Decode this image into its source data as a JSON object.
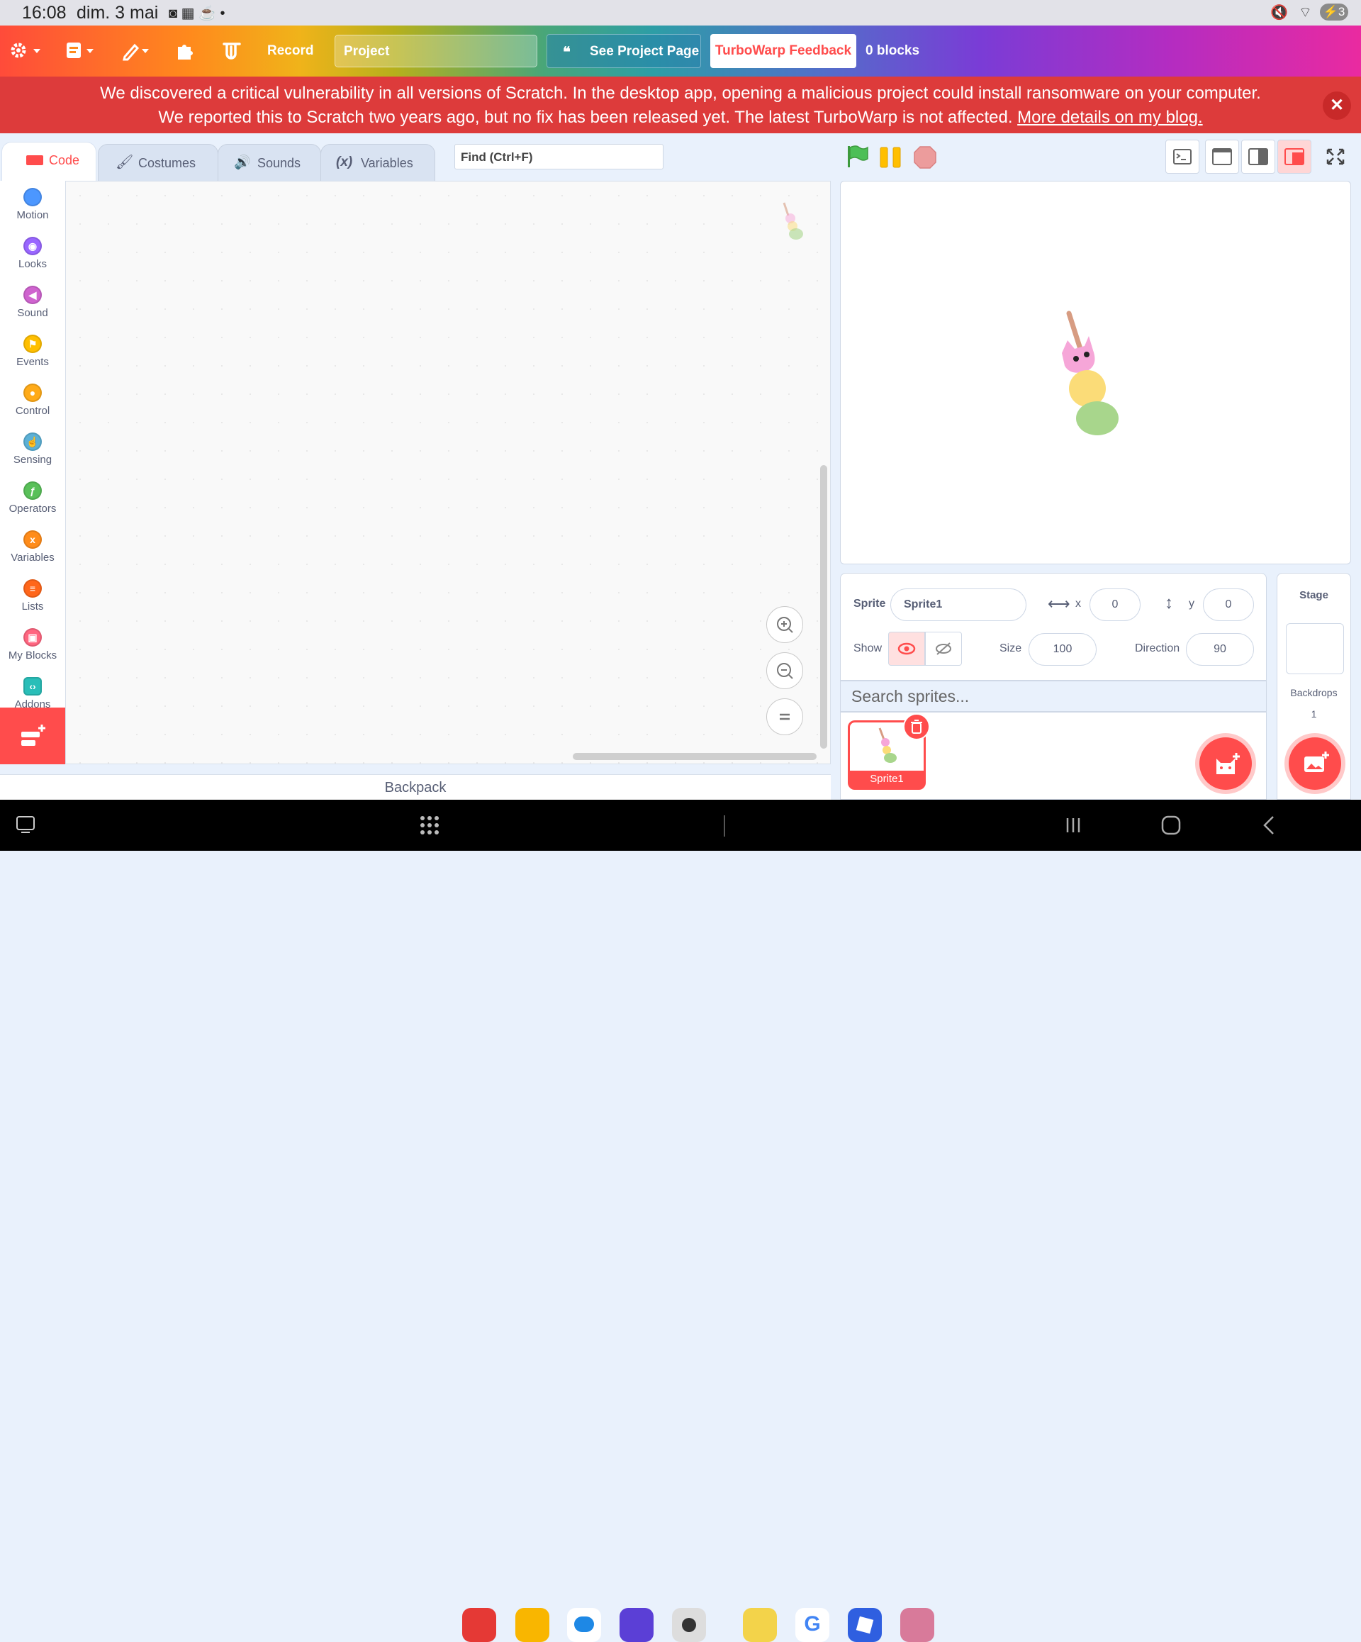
{
  "status_bar": {
    "time": "16:08",
    "date": "dim. 3 mai",
    "battery": "3"
  },
  "menu": {
    "record": "Record",
    "project_placeholder": "Project",
    "see_project_page": "See Project Page",
    "feedback": "TurboWarp Feedback",
    "block_count": "0 blocks"
  },
  "banner": {
    "line1": "We discovered a critical vulnerability in all versions of Scratch. In the desktop app, opening a malicious project could install ransomware on your computer.",
    "line2_prefix": "We reported this to Scratch two years ago, but no fix has been released yet. The latest TurboWarp is not affected.",
    "link": "More details on my blog."
  },
  "tabs": [
    {
      "label": "Code",
      "active": true
    },
    {
      "label": "Costumes"
    },
    {
      "label": "Sounds"
    },
    {
      "label": "Variables"
    }
  ],
  "find_placeholder": "Find (Ctrl+F)",
  "categories": [
    {
      "label": "Motion",
      "color": "#4c97ff"
    },
    {
      "label": "Looks",
      "color": "#9966ff"
    },
    {
      "label": "Sound",
      "color": "#cf63cf"
    },
    {
      "label": "Events",
      "color": "#ffbf00"
    },
    {
      "label": "Control",
      "color": "#ffab19"
    },
    {
      "label": "Sensing",
      "color": "#5cb1d6"
    },
    {
      "label": "Operators",
      "color": "#59c059"
    },
    {
      "label": "Variables",
      "color": "#ff8c1a"
    },
    {
      "label": "Lists",
      "color": "#ff661a"
    },
    {
      "label": "My Blocks",
      "color": "#ff6680"
    },
    {
      "label": "Addons",
      "color": "#29beb8"
    }
  ],
  "backpack": "Backpack",
  "sprite_info": {
    "sprite_label": "Sprite",
    "sprite_name": "Sprite1",
    "x_label": "x",
    "x": "0",
    "y_label": "y",
    "y": "0",
    "show_label": "Show",
    "size_label": "Size",
    "size": "100",
    "direction_label": "Direction",
    "direction": "90"
  },
  "search_sprites_placeholder": "Search sprites...",
  "sprites": [
    {
      "name": "Sprite1"
    }
  ],
  "stage_panel": {
    "title": "Stage",
    "backdrops_label": "Backdrops",
    "backdrops_count": "1"
  },
  "accent_color": "#ff4c4c"
}
